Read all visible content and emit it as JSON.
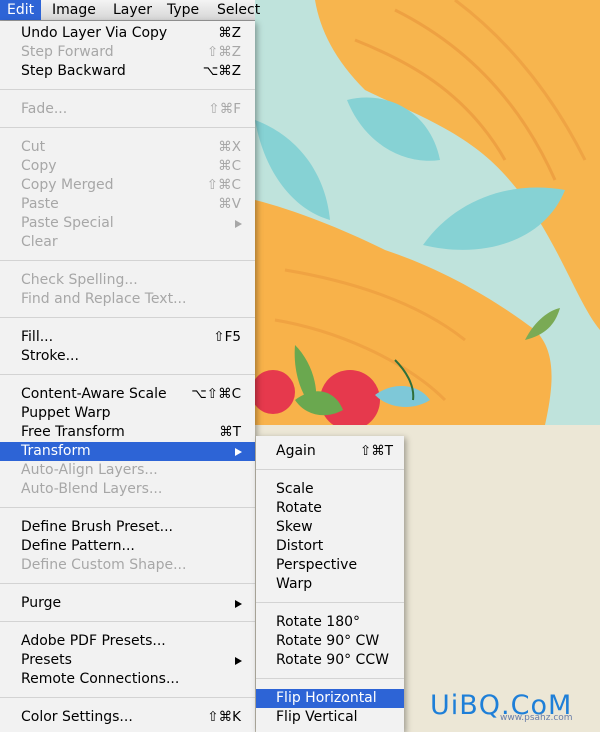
{
  "menubar": {
    "items": [
      "Edit",
      "Image",
      "Layer",
      "Type",
      "Select"
    ],
    "active": "Edit"
  },
  "edit_menu": {
    "items": [
      {
        "label": "Undo Layer Via Copy",
        "shortcut": "⌘Z",
        "enabled": true
      },
      {
        "label": "Step Forward",
        "shortcut": "⇧⌘Z",
        "enabled": false
      },
      {
        "label": "Step Backward",
        "shortcut": "⌥⌘Z",
        "enabled": true
      },
      {
        "label": "Fade...",
        "shortcut": "⇧⌘F",
        "enabled": false
      },
      {
        "label": "Cut",
        "shortcut": "⌘X",
        "enabled": false
      },
      {
        "label": "Copy",
        "shortcut": "⌘C",
        "enabled": false
      },
      {
        "label": "Copy Merged",
        "shortcut": "⇧⌘C",
        "enabled": false
      },
      {
        "label": "Paste",
        "shortcut": "⌘V",
        "enabled": false
      },
      {
        "label": "Paste Special",
        "shortcut": "",
        "enabled": false,
        "submenu": true
      },
      {
        "label": "Clear",
        "shortcut": "",
        "enabled": false
      },
      {
        "label": "Check Spelling...",
        "shortcut": "",
        "enabled": false
      },
      {
        "label": "Find and Replace Text...",
        "shortcut": "",
        "enabled": false
      },
      {
        "label": "Fill...",
        "shortcut": "⇧F5",
        "enabled": true
      },
      {
        "label": "Stroke...",
        "shortcut": "",
        "enabled": true
      },
      {
        "label": "Content-Aware Scale",
        "shortcut": "⌥⇧⌘C",
        "enabled": true
      },
      {
        "label": "Puppet Warp",
        "shortcut": "",
        "enabled": true
      },
      {
        "label": "Free Transform",
        "shortcut": "⌘T",
        "enabled": true
      },
      {
        "label": "Transform",
        "shortcut": "",
        "enabled": true,
        "submenu": true,
        "highlighted": true
      },
      {
        "label": "Auto-Align Layers...",
        "shortcut": "",
        "enabled": false
      },
      {
        "label": "Auto-Blend Layers...",
        "shortcut": "",
        "enabled": false
      },
      {
        "label": "Define Brush Preset...",
        "shortcut": "",
        "enabled": true
      },
      {
        "label": "Define Pattern...",
        "shortcut": "",
        "enabled": true
      },
      {
        "label": "Define Custom Shape...",
        "shortcut": "",
        "enabled": false
      },
      {
        "label": "Purge",
        "shortcut": "",
        "enabled": true,
        "submenu": true
      },
      {
        "label": "Adobe PDF Presets...",
        "shortcut": "",
        "enabled": true
      },
      {
        "label": "Presets",
        "shortcut": "",
        "enabled": true,
        "submenu": true
      },
      {
        "label": "Remote Connections...",
        "shortcut": "",
        "enabled": true
      },
      {
        "label": "Color Settings...",
        "shortcut": "⇧⌘K",
        "enabled": true
      }
    ]
  },
  "transform_submenu": {
    "items": [
      {
        "label": "Again",
        "shortcut": "⇧⌘T"
      },
      {
        "label": "Scale",
        "shortcut": ""
      },
      {
        "label": "Rotate",
        "shortcut": ""
      },
      {
        "label": "Skew",
        "shortcut": ""
      },
      {
        "label": "Distort",
        "shortcut": ""
      },
      {
        "label": "Perspective",
        "shortcut": ""
      },
      {
        "label": "Warp",
        "shortcut": ""
      },
      {
        "label": "Rotate 180°",
        "shortcut": ""
      },
      {
        "label": "Rotate 90° CW",
        "shortcut": ""
      },
      {
        "label": "Rotate 90° CCW",
        "shortcut": ""
      },
      {
        "label": "Flip Horizontal",
        "shortcut": "",
        "highlighted": true
      },
      {
        "label": "Flip Vertical",
        "shortcut": ""
      }
    ]
  },
  "watermark": {
    "main": "UiBQ.CoM",
    "sub": "www.psahz.com"
  },
  "colors": {
    "highlight": "#2d64d6",
    "menu_bg": "#f2f2f2",
    "disabled_text": "#a7a7a7",
    "canvas_teal": "#bfe3dc",
    "hair_orange": "#f7b54e"
  }
}
